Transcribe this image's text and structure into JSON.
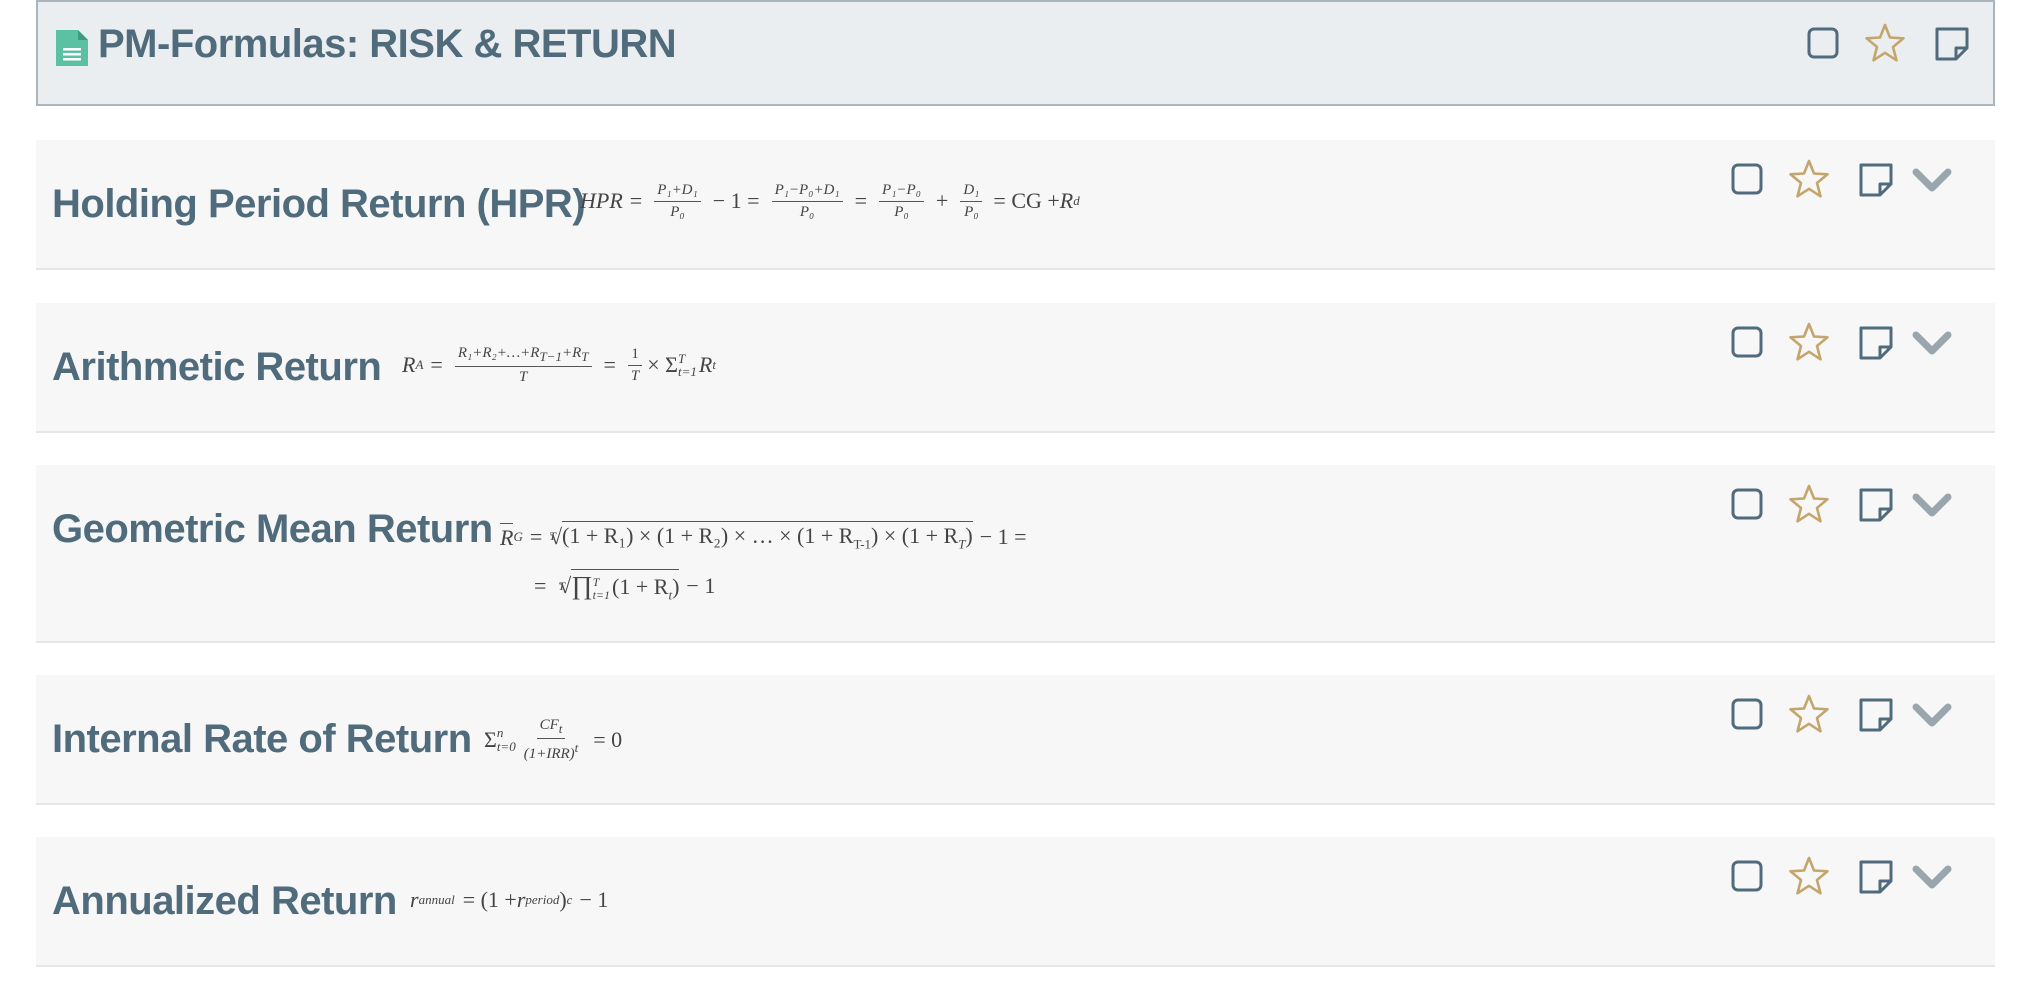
{
  "header": {
    "title": "PM-Formulas: RISK & RETURN"
  },
  "cards": [
    {
      "title": "Holding Period Return (HPR)"
    },
    {
      "title": "Arithmetic Return"
    },
    {
      "title": "Geometric Mean Return"
    },
    {
      "title": "Internal Rate of Return"
    },
    {
      "title": "Annualized Return"
    }
  ],
  "formulas": {
    "hpr": {
      "lhs": "HPR",
      "eq": "=",
      "f1_num": "P₁+D₁",
      "f1_den": "P₀",
      "minus_one": "− 1 =",
      "f2_num": "P₁−P₀+D₁",
      "f2_den": "P₀",
      "eq2": "=",
      "f3_num": "P₁−P₀",
      "f3_den": "P₀",
      "plus": "+",
      "f4_num": "D₁",
      "f4_den": "P₀",
      "tail_eq": "= CG + ",
      "tail_r": "R",
      "tail_sub": "d"
    },
    "arith": {
      "lhs": "R",
      "lhs_sub": "A",
      "eq": "=",
      "num": "R₁+R₂+…+R",
      "num_sub1": "T−1",
      "num_plus": "+R",
      "num_sub2": "T",
      "den": "T",
      "eq2": "=",
      "one_num": "1",
      "one_den": "T",
      "times": "× Σ",
      "sum_sup": "T",
      "sum_sub": "t=1",
      "r": "R",
      "r_sub": "t"
    },
    "geo": {
      "lhs": "R",
      "lhs_sub": "G",
      "eq": "=",
      "root_index": "T",
      "radicand": "(1 + R₁) × (1 + R₂) × … × (1 + R",
      "radicand_sub1": "T-1",
      "radicand_mid": ") × (1 + R",
      "radicand_sub2": "T",
      "radicand_end": ")",
      "tail": "− 1 =",
      "line2_eq": "=",
      "root_index2": "T",
      "prod": "∏",
      "prod_sup": "T",
      "prod_sub": "t=1",
      "prod_body": "(1 + R",
      "prod_body_sub": "t",
      "prod_close": ")",
      "tail2": "− 1"
    },
    "irr": {
      "sigma": "Σ",
      "sum_sup": "n",
      "sum_sub": "t=0",
      "num": "CF",
      "num_sub": "t",
      "den": "(1+IRR)",
      "den_sup": "t",
      "eq": "= 0"
    },
    "annual": {
      "lhs": "r",
      "lhs_sub": "annual",
      "eq": "= (1 + ",
      "r": "r",
      "r_sub": "period",
      "close": ")",
      "sup": "c",
      "tail": "− 1"
    }
  },
  "colors": {
    "text": "#4f6b7c",
    "icon": "#4f6b7c",
    "star": "#c4a66c",
    "chevron": "#9aa6ae",
    "doc_icon": "#5cc0a2"
  }
}
